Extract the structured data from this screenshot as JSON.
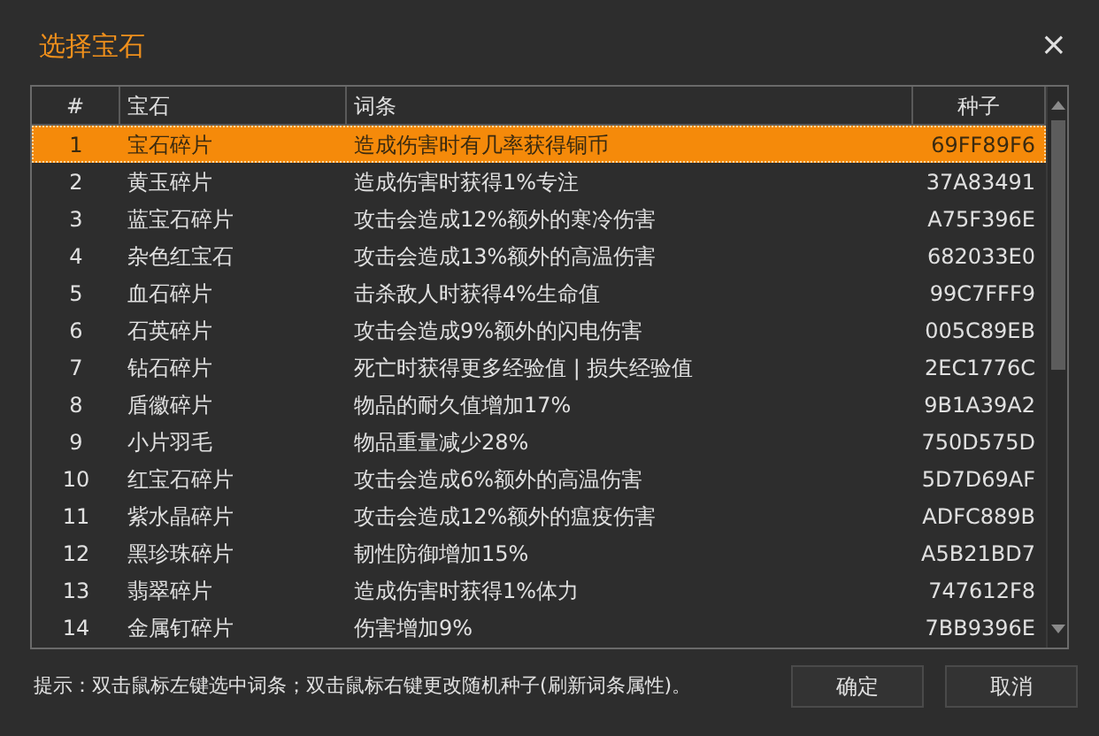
{
  "window": {
    "title": "选择宝石",
    "close": "×"
  },
  "table": {
    "columns": [
      "#",
      "宝石",
      "词条",
      "种子"
    ],
    "rows": [
      {
        "cells": [
          "1",
          "宝石碎片",
          "造成伤害时有几率获得铜币",
          "69FF89F6"
        ],
        "selected": true
      },
      {
        "cells": [
          "2",
          "黄玉碎片",
          "造成伤害时获得1%专注",
          "37A83491"
        ],
        "selected": false
      },
      {
        "cells": [
          "3",
          "蓝宝石碎片",
          "攻击会造成12%额外的寒冷伤害",
          "A75F396E"
        ],
        "selected": false
      },
      {
        "cells": [
          "4",
          "杂色红宝石",
          "攻击会造成13%额外的高温伤害",
          "682033E0"
        ],
        "selected": false
      },
      {
        "cells": [
          "5",
          "血石碎片",
          "击杀敌人时获得4%生命值",
          "99C7FFF9"
        ],
        "selected": false
      },
      {
        "cells": [
          "6",
          "石英碎片",
          "攻击会造成9%额外的闪电伤害",
          "005C89EB"
        ],
        "selected": false
      },
      {
        "cells": [
          "7",
          "钻石碎片",
          "死亡时获得更多经验值 | 损失经验值",
          "2EC1776C"
        ],
        "selected": false
      },
      {
        "cells": [
          "8",
          "盾徽碎片",
          "物品的耐久值增加17%",
          "9B1A39A2"
        ],
        "selected": false
      },
      {
        "cells": [
          "9",
          "小片羽毛",
          "物品重量减少28%",
          "750D575D"
        ],
        "selected": false
      },
      {
        "cells": [
          "10",
          "红宝石碎片",
          "攻击会造成6%额外的高温伤害",
          "5D7D69AF"
        ],
        "selected": false
      },
      {
        "cells": [
          "11",
          "紫水晶碎片",
          "攻击会造成12%额外的瘟疫伤害",
          "ADFC889B"
        ],
        "selected": false
      },
      {
        "cells": [
          "12",
          "黑珍珠碎片",
          "韧性防御增加15%",
          "A5B21BD7"
        ],
        "selected": false
      },
      {
        "cells": [
          "13",
          "翡翠碎片",
          "造成伤害时获得1%体力",
          "747612F8"
        ],
        "selected": false
      },
      {
        "cells": [
          "14",
          "金属钉碎片",
          "伤害增加9%",
          "7BB9396E"
        ],
        "selected": false
      }
    ]
  },
  "footer": {
    "hint": "提示：双击鼠标左键选中词条；双击鼠标右键更改随机种子(刷新词条属性)。",
    "buttons": [
      "确定",
      "取消"
    ]
  }
}
